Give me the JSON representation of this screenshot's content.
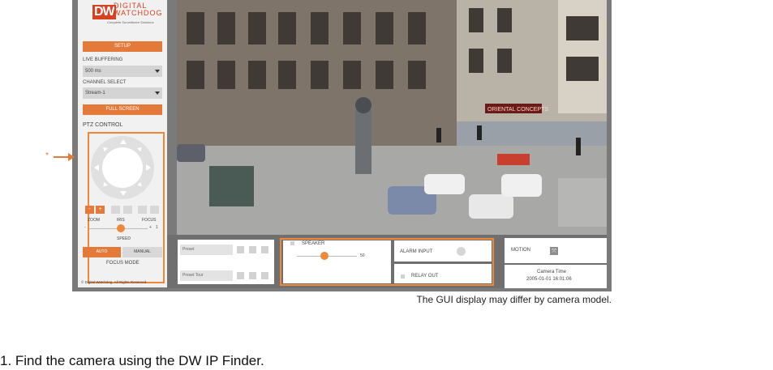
{
  "logo": {
    "mark": "DW",
    "brand_line1": "DIGITAL",
    "brand_line2": "WATCHDOG",
    "tagline": "Complete Surveillance Solutions"
  },
  "sidebar": {
    "setup_label": "SETUP",
    "live_buffering_label": "LIVE BUFFERING",
    "live_buffering_value": "500 ms",
    "channel_select_label": "CHANNEL SELECT",
    "channel_select_value": "Stream-1",
    "fullscreen_label": "FULL SCREEN",
    "ptz_label": "PTZ CONTROL",
    "zoom_label": "ZOOM",
    "iris_label": "IRIS",
    "focus_label": "FOCUS",
    "zoom_minus": "-",
    "zoom_plus": "+",
    "speed_min": "-",
    "speed_max": "+",
    "speed_value": "1",
    "speed_label": "SPEED",
    "auto_label": "AUTO",
    "manual_label": "MANUAL",
    "focus_mode_label": "FOCUS MODE",
    "copyright": "© Digital Watchdog. All Rights Reserved."
  },
  "video": {
    "shop_sign": "ORIENTAL CONCEPTS"
  },
  "bottom": {
    "preset_placeholder": "Preset",
    "preset_tour_placeholder": "Preset Tour",
    "speaker_label": "SPEAKER",
    "speaker_value": "50",
    "alarm_input_label": "ALARM INPUT",
    "relay_out_label": "RELAY OUT",
    "motion_label": "MOTION",
    "camera_time_label": "Camera Time",
    "camera_time_value": "2005-01-01 16:01:06"
  },
  "annotation": {
    "marker": "*"
  },
  "caption": "The GUI display may differ by camera model.",
  "step": "1.  Find the camera using the DW IP Finder.",
  "colors": {
    "accent": "#e47a3a",
    "highlight": "#f0883a",
    "frame": "#7a7a7a"
  }
}
